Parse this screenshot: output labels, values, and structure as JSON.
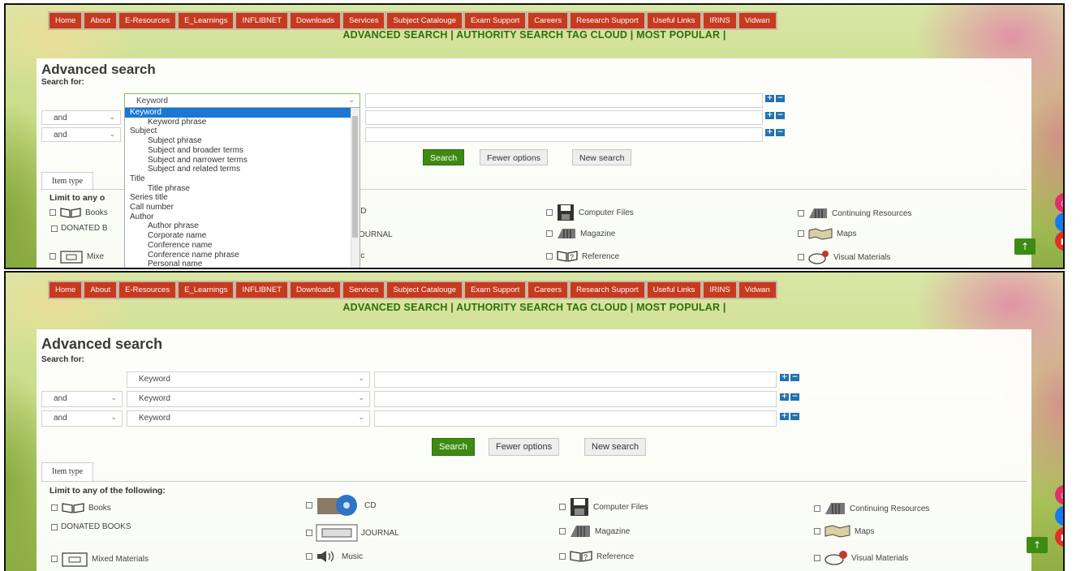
{
  "nav": [
    "Home",
    "About",
    "E-Resources",
    "E_Learnings",
    "INFLIBNET",
    "Downloads",
    "Services",
    "Subject Catalouge",
    "Exam Support",
    "Careers",
    "Research Support",
    "Useful Links",
    "IRINS",
    "Vidwan"
  ],
  "subnav": "ADVANCED SEARCH | AUTHORITY SEARCH TAG CLOUD | MOST POPULAR |",
  "page_title": "Advanced search",
  "search_for": "Search for:",
  "operator_value": "and",
  "index_value": "Keyword",
  "buttons": {
    "search": "Search",
    "fewer": "Fewer options",
    "new": "New search"
  },
  "tab_item_type": "Item type",
  "limit_label": "Limit to any of the following:",
  "limit_label_cut": "Limit to any o",
  "item_types": [
    "Books",
    "CD",
    "Computer Files",
    "Continuing Resources",
    "DONATED BOOKS",
    "JOURNAL",
    "Magazine",
    "Maps",
    "Mixed Materials",
    "Music",
    "Reference",
    "Visual Materials"
  ],
  "cut_labels": {
    "books": "Books",
    "donated": "DONATED B",
    "mixed": "Mixe",
    "cd": "CD",
    "journal": "JOURNAL",
    "music": "sic"
  },
  "dropdown_options": [
    {
      "label": "Keyword",
      "sub": false,
      "selected": true
    },
    {
      "label": "Keyword phrase",
      "sub": true
    },
    {
      "label": "Subject",
      "sub": false
    },
    {
      "label": "Subject phrase",
      "sub": true
    },
    {
      "label": "Subject and broader terms",
      "sub": true
    },
    {
      "label": "Subject and narrower terms",
      "sub": true
    },
    {
      "label": "Subject and related terms",
      "sub": true
    },
    {
      "label": "Title",
      "sub": false
    },
    {
      "label": "Title phrase",
      "sub": true
    },
    {
      "label": "Series title",
      "sub": false
    },
    {
      "label": "Call number",
      "sub": false
    },
    {
      "label": "Author",
      "sub": false
    },
    {
      "label": "Author phrase",
      "sub": true
    },
    {
      "label": "Corporate name",
      "sub": true
    },
    {
      "label": "Conference name",
      "sub": true
    },
    {
      "label": "Conference name phrase",
      "sub": true
    },
    {
      "label": "Personal name",
      "sub": true
    }
  ],
  "icons": {
    "plus": "+",
    "minus": "−",
    "up": "↑",
    "facebook": "f"
  },
  "colors": {
    "nav_bg": "#c63a1f",
    "accent_green": "#3e8a12",
    "subnav_text": "#2f6f0c",
    "dropdown_highlight": "#1a78d2"
  }
}
